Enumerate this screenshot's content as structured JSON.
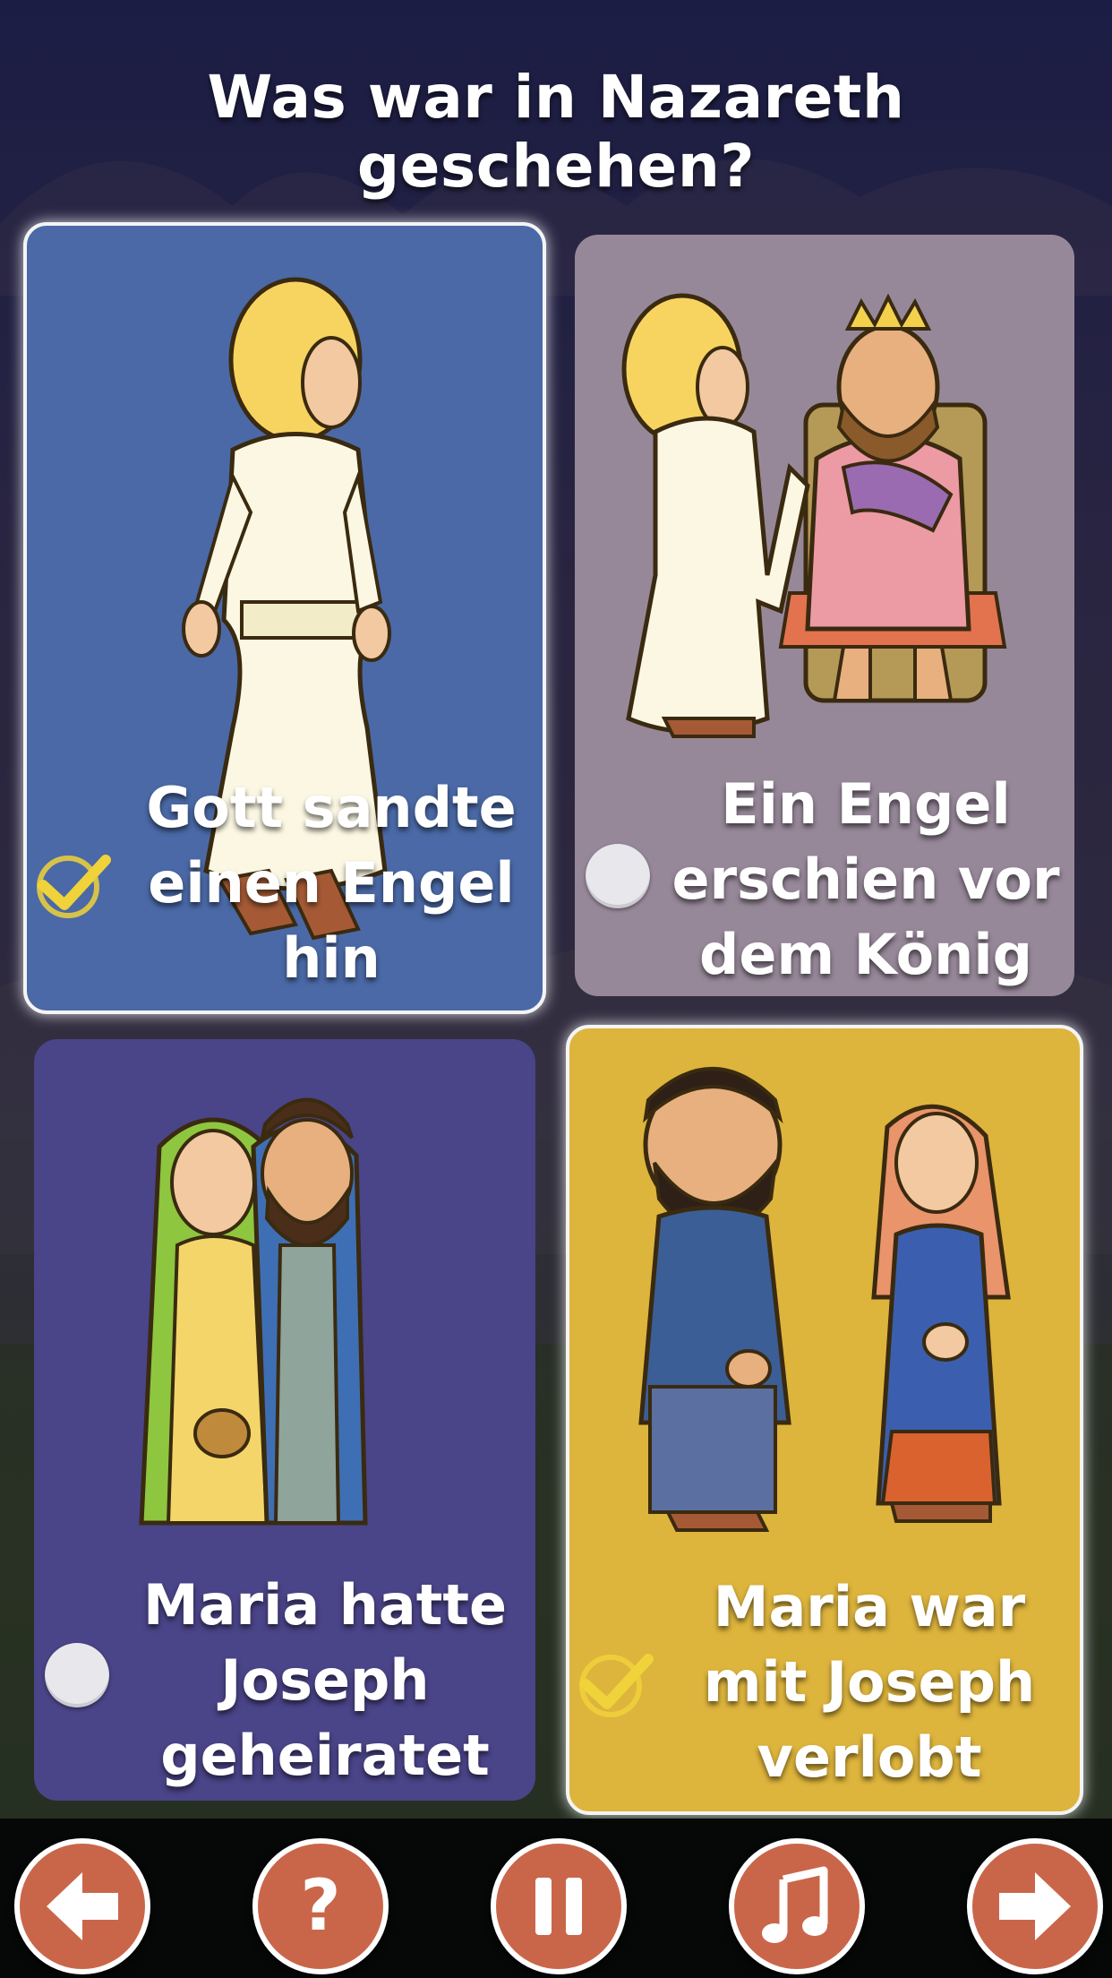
{
  "quiz": {
    "question": "Was war in Nazareth geschehen?",
    "answers": [
      {
        "label": "Gott sandte einen Engel hin",
        "selected": true,
        "color": "#4a69a6"
      },
      {
        "label": "Ein Engel erschien vor dem König",
        "selected": false,
        "color": "#978899"
      },
      {
        "label": "Maria hatte Joseph geheiratet",
        "selected": false,
        "color": "#4a4488"
      },
      {
        "label": "Maria war mit Joseph verlobt",
        "selected": true,
        "color": "#ddb43c"
      }
    ]
  },
  "nav": {
    "back": "arrow-left-icon",
    "help": "question-mark-icon",
    "pause": "pause-icon",
    "music": "music-note-icon",
    "next": "arrow-right-icon",
    "button_color": "#c9664a"
  },
  "colors": {
    "check": "#f0d23a",
    "radio": "#e8e8ec"
  }
}
